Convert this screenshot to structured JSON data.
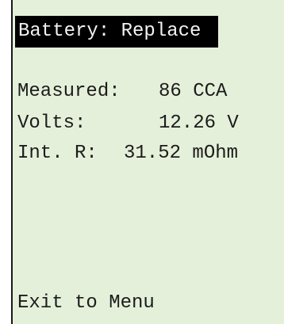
{
  "screen": {
    "header": "Battery: Replace",
    "readings": [
      {
        "label": "Measured:",
        "value": "86 CCA"
      },
      {
        "label": "Volts:",
        "value": "12.26 V"
      },
      {
        "label": "Int. R:",
        "value": "31.52 mOhm"
      }
    ],
    "footer": "Exit to Menu"
  },
  "colors": {
    "lcd_background": "#e5f0da",
    "header_background": "#000000",
    "header_text": "#f2f2f2",
    "text": "#1c1c1c"
  }
}
